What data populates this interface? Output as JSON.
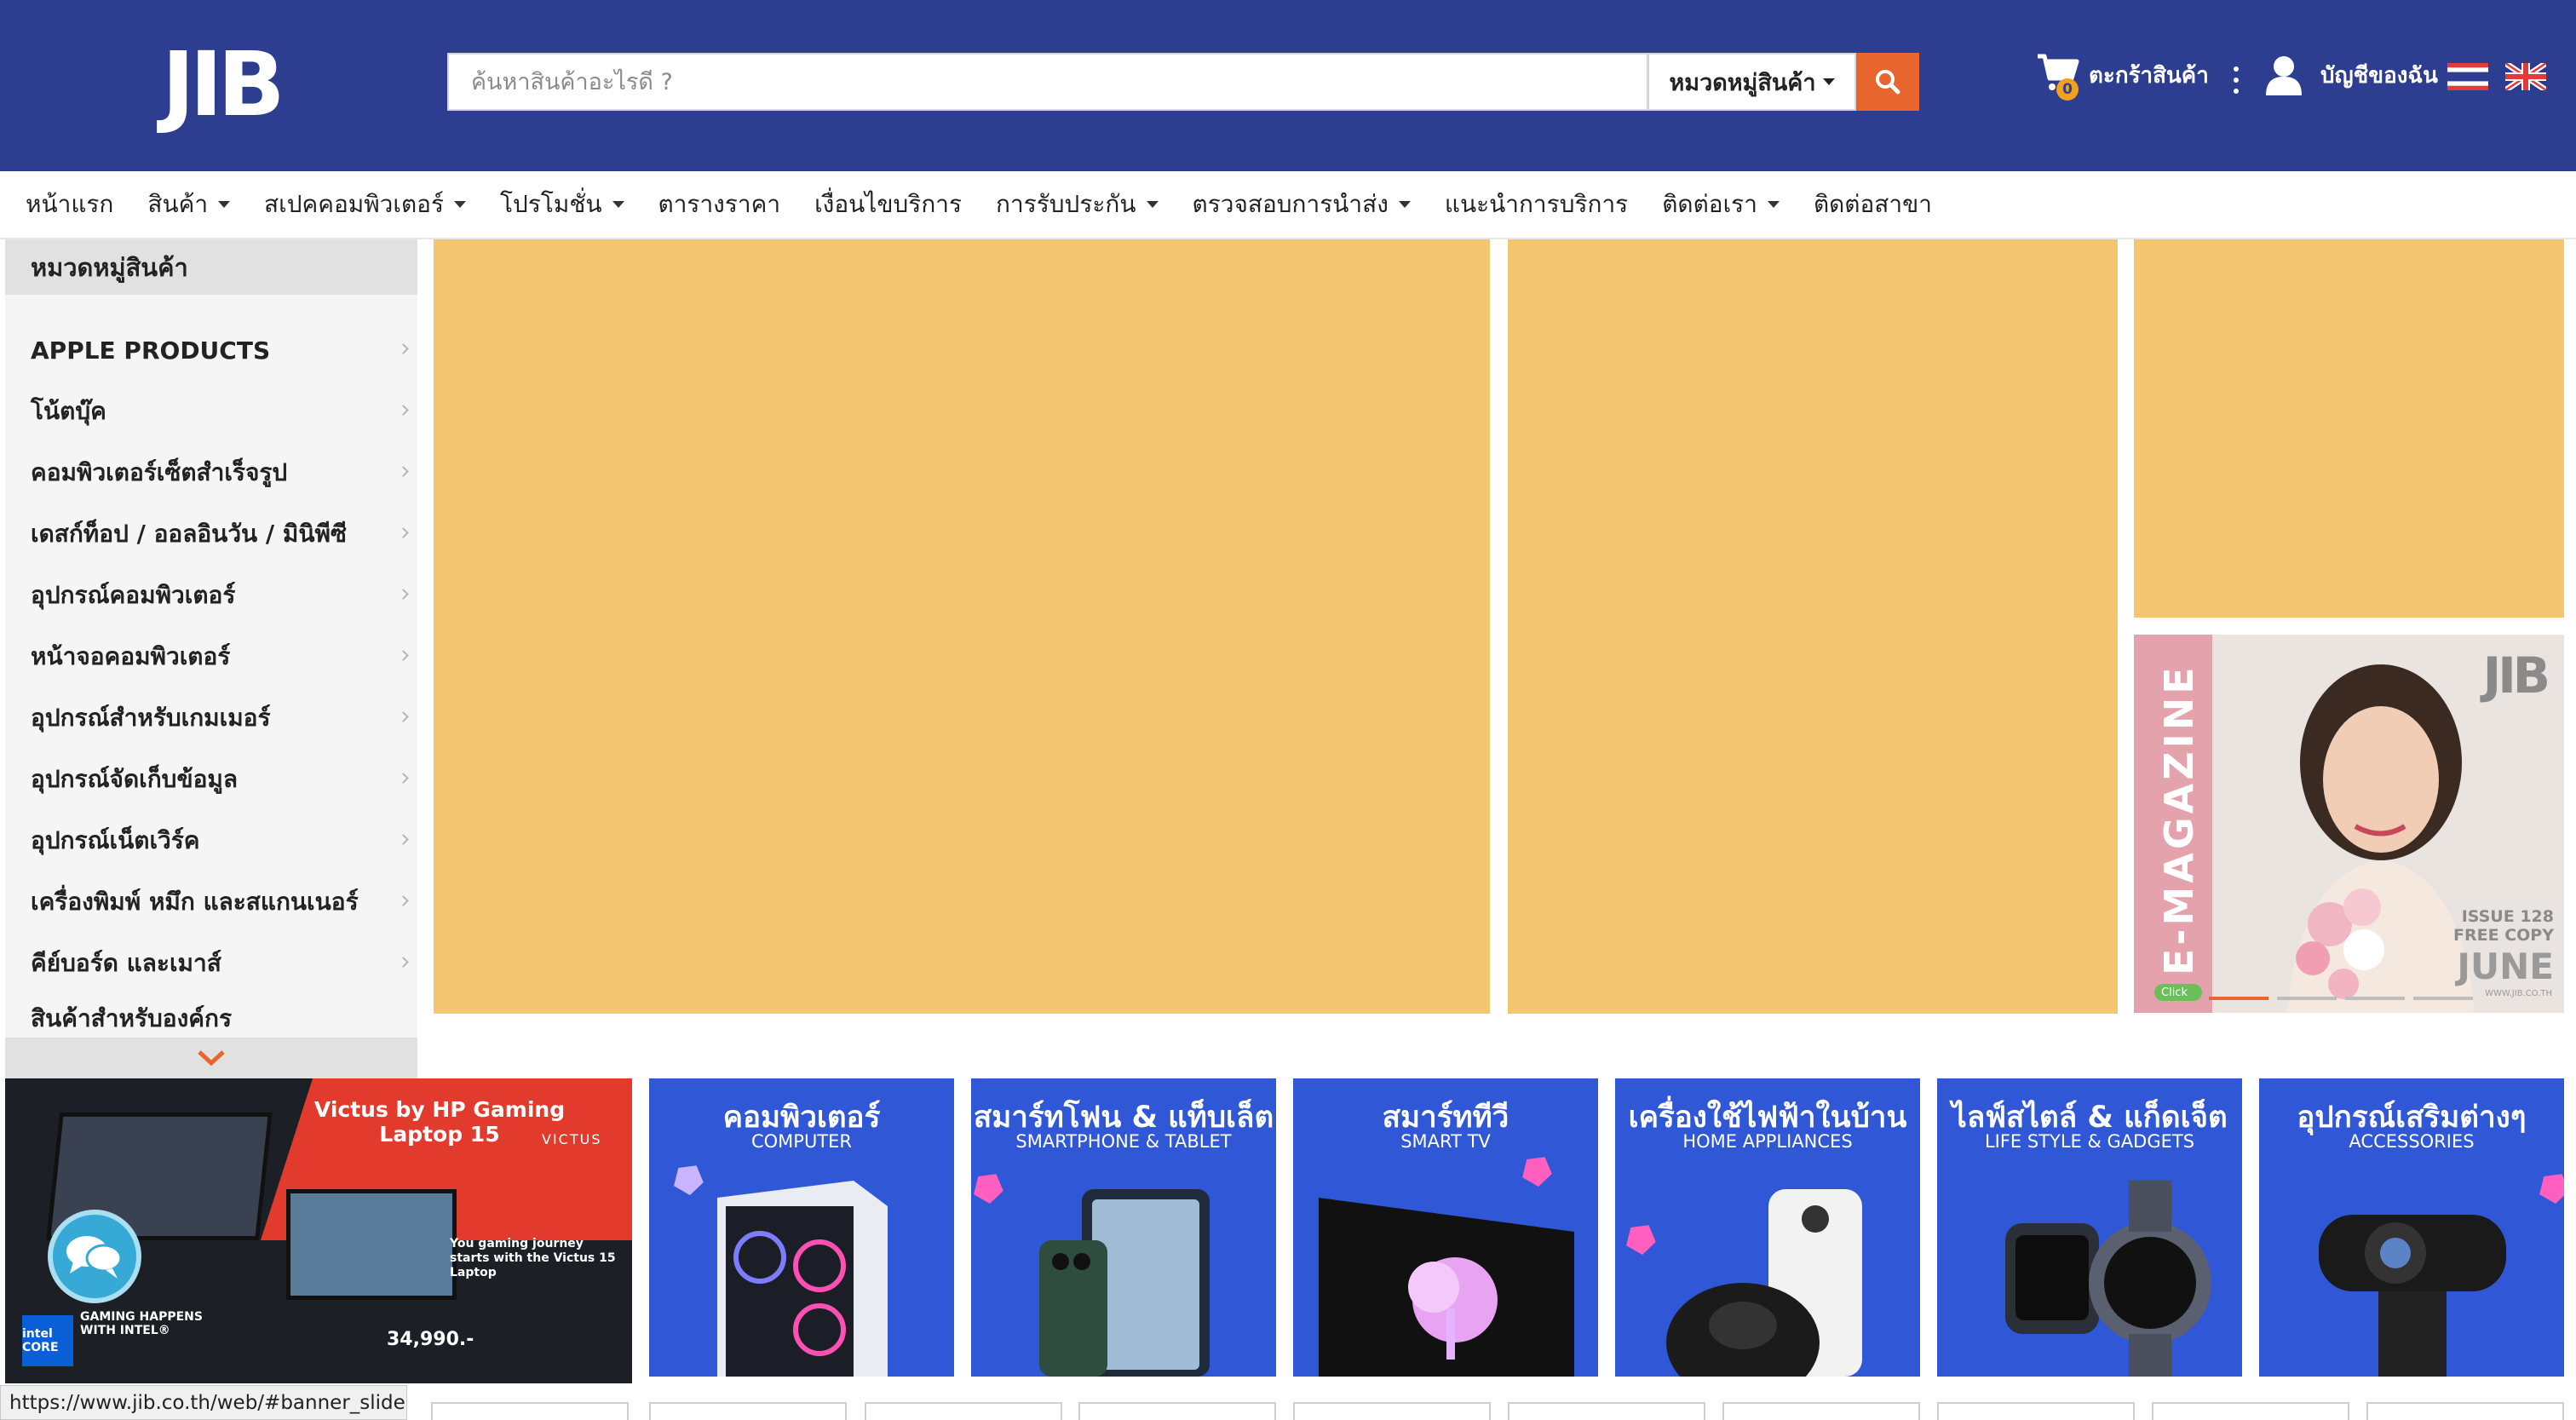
{
  "header": {
    "logo_text": "JIB",
    "search_placeholder": "ค้นหาสินค้าอะไรดี ?",
    "category_select": "หมวดหมู่สินค้า",
    "cart_label": "ตะกร้าสินค้า",
    "cart_count": "0",
    "account_label": "บัญชีของฉัน",
    "colors": {
      "header_bg": "#2d3d8f",
      "search_button": "#e8652d",
      "badge": "#f3a11a"
    },
    "icons": [
      "search-icon",
      "cart-icon",
      "kebab-menu-icon",
      "user-icon",
      "thai-flag-icon",
      "uk-flag-icon"
    ]
  },
  "nav": {
    "items": [
      {
        "label": "หน้าแรก",
        "dropdown": false
      },
      {
        "label": "สินค้า",
        "dropdown": true
      },
      {
        "label": "สเปคคอมพิวเตอร์",
        "dropdown": true
      },
      {
        "label": "โปรโมชั่น",
        "dropdown": true
      },
      {
        "label": "ตารางราคา",
        "dropdown": false
      },
      {
        "label": "เงื่อนไขบริการ",
        "dropdown": false
      },
      {
        "label": "การรับประกัน",
        "dropdown": true
      },
      {
        "label": "ตรวจสอบการนำส่ง",
        "dropdown": true
      },
      {
        "label": "แนะนำการบริการ",
        "dropdown": false
      },
      {
        "label": "ติดต่อเรา",
        "dropdown": true
      },
      {
        "label": "ติดต่อสาขา",
        "dropdown": false
      }
    ]
  },
  "sidebar": {
    "heading": "หมวดหมู่สินค้า",
    "items": [
      {
        "label": "APPLE PRODUCTS"
      },
      {
        "label": "โน้ตบุ๊ค"
      },
      {
        "label": "คอมพิวเตอร์เซ็ตสำเร็จรูป"
      },
      {
        "label": "เดสก์ท็อป / ออลอินวัน / มินิพีซี"
      },
      {
        "label": "อุปกรณ์คอมพิวเตอร์"
      },
      {
        "label": "หน้าจอคอมพิวเตอร์"
      },
      {
        "label": "อุปกรณ์สำหรับเกมเมอร์"
      },
      {
        "label": "อุปกรณ์จัดเก็บข้อมูล"
      },
      {
        "label": "อุปกรณ์เน็ตเวิร์ค"
      },
      {
        "label": "เครื่องพิมพ์ หมึก และสแกนเนอร์"
      },
      {
        "label": "คีย์บอร์ด และเมาส์"
      },
      {
        "label": "สินค้าสำหรับองค์กร"
      }
    ],
    "expand_icon": "chevron-down-icon"
  },
  "banners": {
    "placeholder_color": "#f5c672",
    "magazine": {
      "title": "E-MAGAZINE",
      "logo": "JIB",
      "issue": "ISSUE 128",
      "free": "FREE COPY",
      "month": "JUNE",
      "site": "WWW.JIB.CO.TH",
      "click": "Click"
    }
  },
  "promos": {
    "victus": {
      "title": "Victus by HP Gaming Laptop 15",
      "brand": "VICTUS",
      "tagline": "You gaming journey starts with the Victus 15 Laptop",
      "gaming": "GAMING HAPPENS WITH INTEL®",
      "intel": "intel CORE",
      "price": "34,990.-"
    },
    "categories": [
      {
        "title": "คอมพิวเตอร์",
        "sub": "COMPUTER"
      },
      {
        "title": "สมาร์ทโฟน & แท็บเล็ต",
        "sub": "SMARTPHONE & TABLET"
      },
      {
        "title": "สมาร์ททีวี",
        "sub": "SMART TV"
      },
      {
        "title": "เครื่องใช้ไฟฟ้าในบ้าน",
        "sub": "HOME APPLIANCES"
      },
      {
        "title": "ไลฟ์สไตล์ & แก็ดเจ็ต",
        "sub": "LIFE STYLE & GADGETS"
      },
      {
        "title": "อุปกรณ์เสริมต่างๆ",
        "sub": "ACCESSORIES"
      }
    ]
  },
  "status_url": "https://www.jib.co.th/web/#banner_slide"
}
